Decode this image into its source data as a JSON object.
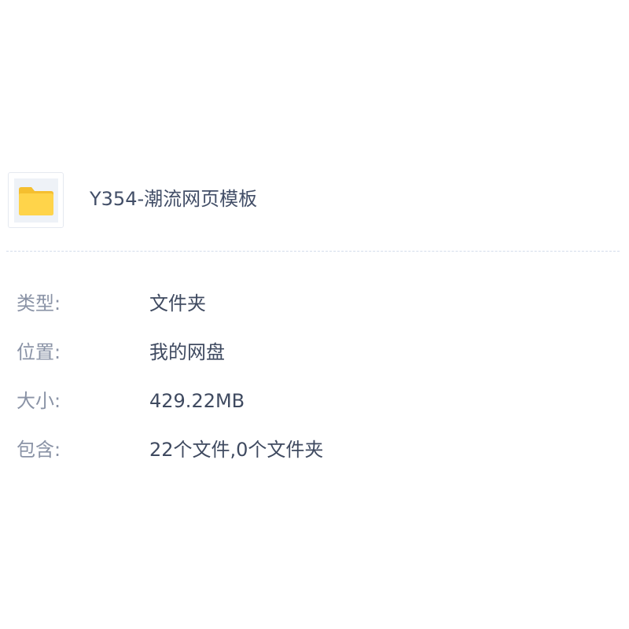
{
  "file": {
    "name": "Y354-潮流网页模板",
    "icon": "folder-icon",
    "icon_color": "#ffd44a"
  },
  "properties": [
    {
      "label": "类型:",
      "value": "文件夹"
    },
    {
      "label": "位置:",
      "value": "我的网盘"
    },
    {
      "label": "大小:",
      "value": "429.22MB"
    },
    {
      "label": "包含:",
      "value": "22个文件,0个文件夹"
    }
  ]
}
